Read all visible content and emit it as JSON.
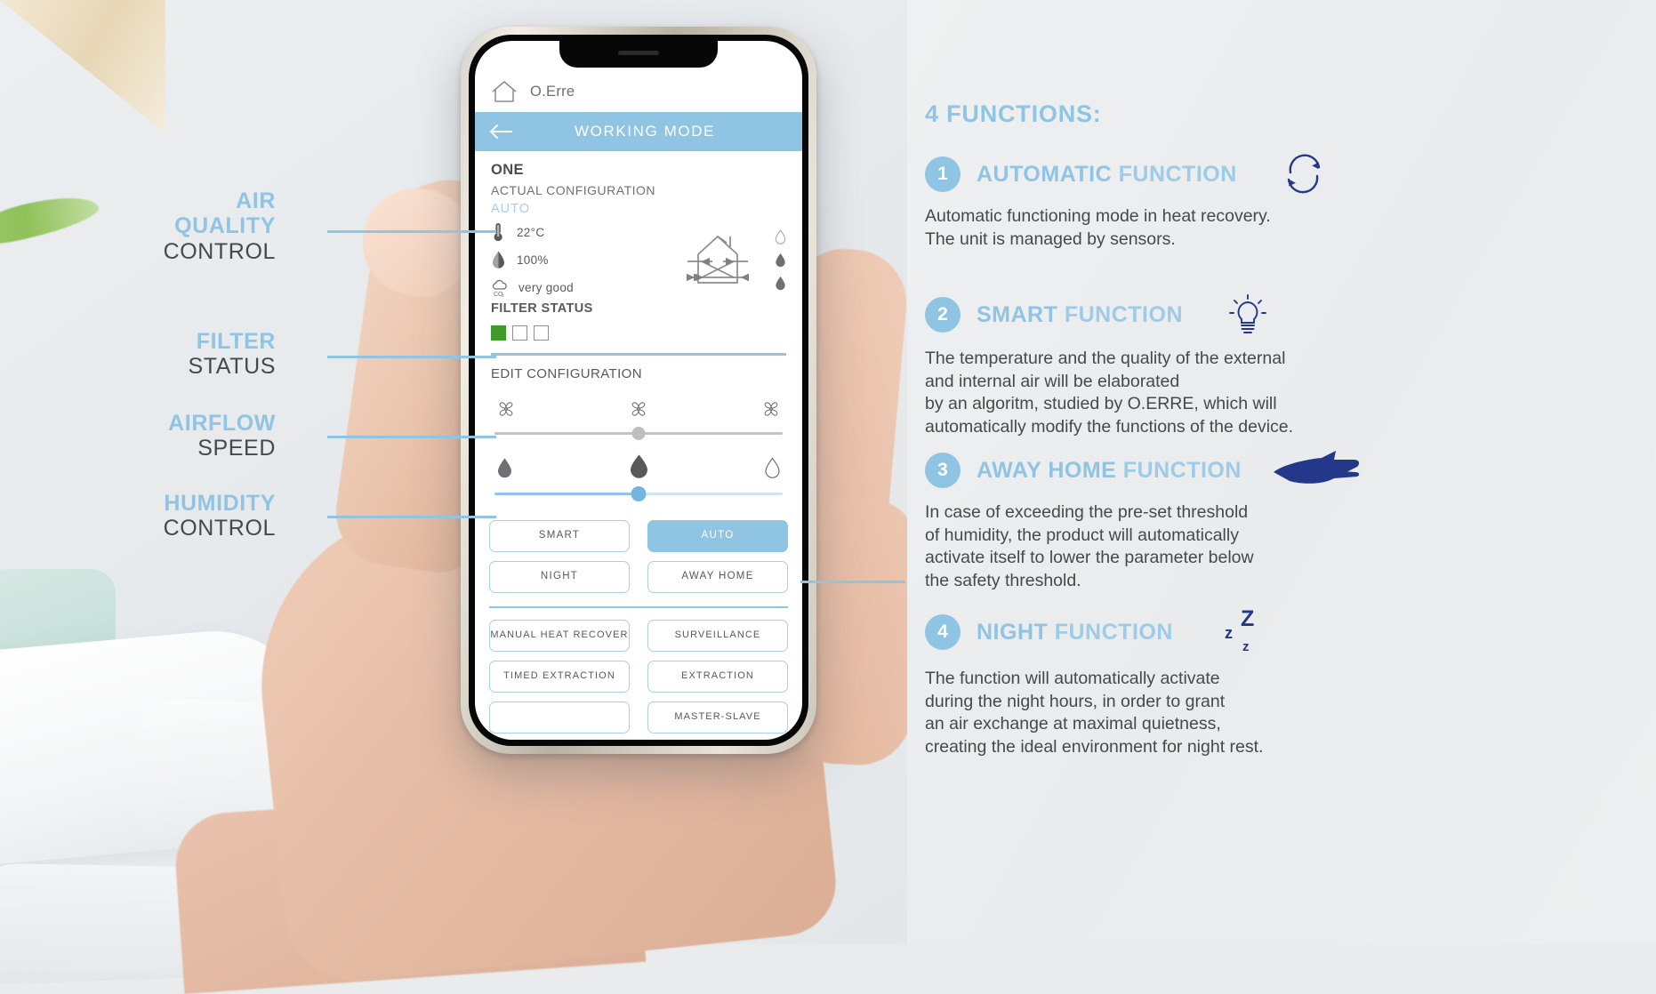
{
  "phone_app": {
    "brand": "O.Erre",
    "home_icon": "home-icon",
    "titlebar": {
      "back_icon": "back-arrow-icon",
      "title": "WORKING MODE"
    },
    "actual": {
      "device_name": "ONE",
      "section_label": "ACTUAL CONFIGURATION",
      "mode": "AUTO",
      "readouts": [
        {
          "icon": "thermometer-icon",
          "value": "22°C"
        },
        {
          "icon": "humidity-drop-icon",
          "value": "100%"
        },
        {
          "icon": "co2-cloud-icon",
          "value": "very good"
        }
      ],
      "diagram_icon": "house-heat-recovery-icon",
      "diagram_drops": [
        "outline",
        "filled",
        "filled"
      ]
    },
    "filter": {
      "title": "FILTER STATUS",
      "boxes": [
        true,
        false,
        false
      ],
      "on_color": "#3f9b29"
    },
    "edit": {
      "title": "EDIT CONFIGURATION",
      "fan_icons": [
        "fan-icon-small",
        "fan-icon-medium",
        "fan-icon-large"
      ],
      "airflow_slider": {
        "value_pct": 50,
        "color": "#bdbec0"
      },
      "drop_icons": [
        "drop-filled",
        "drop-filled-large",
        "drop-outline"
      ],
      "humidity_slider": {
        "value_pct": 50,
        "color": "#72b5dd"
      }
    },
    "modes": [
      {
        "label": "SMART",
        "active": false
      },
      {
        "label": "AUTO",
        "active": true
      },
      {
        "label": "NIGHT",
        "active": false
      },
      {
        "label": "AWAY HOME",
        "active": false
      }
    ],
    "extra_modes": [
      {
        "label": "MANUAL HEAT RECOVER",
        "active": false
      },
      {
        "label": "SURVEILLANCE",
        "active": false
      },
      {
        "label": "TIMED EXTRACTION",
        "active": false
      },
      {
        "label": "EXTRACTION",
        "active": false
      },
      {
        "label": "",
        "active": false
      },
      {
        "label": "MASTER-SLAVE",
        "active": false
      }
    ]
  },
  "annotations": [
    {
      "line1": "AIR",
      "line1b": "QUALITY",
      "line2": "CONTROL"
    },
    {
      "line1": "FILTER",
      "line2": "STATUS"
    },
    {
      "line1": "AIRFLOW",
      "line2": "SPEED"
    },
    {
      "line1": "HUMIDITY",
      "line2": "CONTROL"
    }
  ],
  "right_panel": {
    "title": "4 FUNCTIONS:",
    "functions": [
      {
        "number": "1",
        "name_bold": "AUTOMATIC",
        "name_light": "FUNCTION",
        "icon": "refresh-cycle-icon",
        "body": "Automatic functioning mode in heat recovery.\nThe unit is managed by sensors."
      },
      {
        "number": "2",
        "name_bold": "SMART",
        "name_light": "FUNCTION",
        "icon": "lightbulb-icon",
        "body": "The temperature and the quality of the external\nand internal air will be elaborated\nby an algoritm, studied by O.ERRE, which will\nautomatically modify the functions of the device."
      },
      {
        "number": "3",
        "name_bold": "AWAY HOME",
        "name_light": "FUNCTION",
        "icon": "airplane-icon",
        "body": "In case of exceeding the pre-set threshold\nof humidity, the product will automatically\nactivate itself to lower the parameter below\nthe safety threshold."
      },
      {
        "number": "4",
        "name_bold": "NIGHT",
        "name_light": "FUNCTION",
        "icon": "sleep-zzz-icon",
        "body": "The function will automatically activate\nduring the night hours, in order to grant\nan air exchange at maximal quietness,\ncreating the ideal environment for night rest."
      }
    ]
  },
  "colors": {
    "accent_blue": "#8fc4e3",
    "icon_navy": "#24388a",
    "filter_green": "#3f9b29",
    "text_dark": "#46484b"
  }
}
